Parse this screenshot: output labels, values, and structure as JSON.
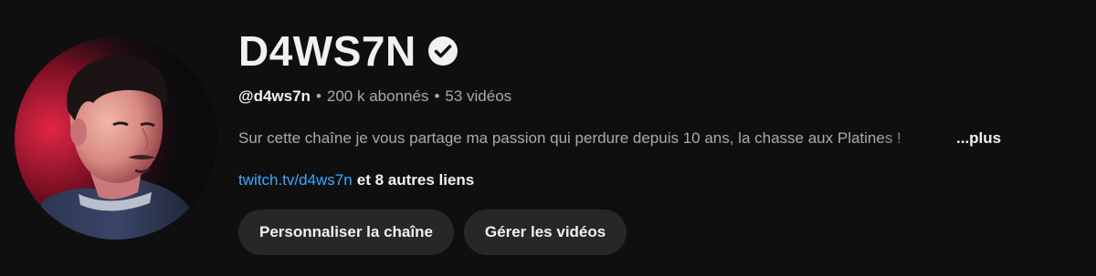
{
  "channel": {
    "name": "D4WS7N",
    "verified": true,
    "handle": "@d4ws7n",
    "separator": "•",
    "subscribers": "200 k abonnés",
    "videos": "53 vidéos",
    "description": "Sur cette chaîne je vous partage ma passion qui perdure depuis 10 ans, la chasse aux Platines !",
    "more_label": "...plus",
    "primary_link": "twitch.tv/d4ws7n",
    "more_links": "et 8 autres liens"
  },
  "actions": {
    "customize_label": "Personnaliser la chaîne",
    "manage_videos_label": "Gérer les vidéos"
  },
  "colors": {
    "background": "#0f0f0f",
    "button_bg": "#272727",
    "link": "#3ea6ff",
    "secondary_text": "#aaaaaa",
    "primary_text": "#f1f1f1"
  },
  "icons": {
    "verified": "check-circle-icon"
  }
}
